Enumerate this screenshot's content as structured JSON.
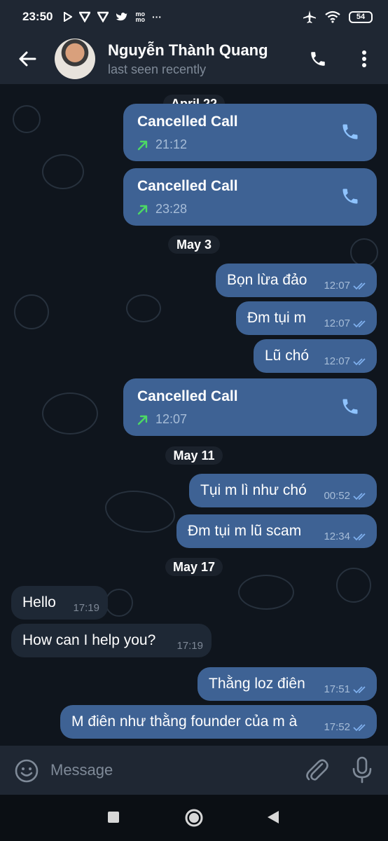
{
  "status_bar": {
    "time": "23:50",
    "left_icons": [
      "play-icon",
      "shield-icon",
      "shield-icon",
      "twitter-icon",
      "momo-icon",
      "more-dots-icon"
    ],
    "momo_text": "mo\nmo",
    "more": "···",
    "right_icons": [
      "airplane-icon",
      "wifi-icon",
      "battery-icon"
    ],
    "battery": "54"
  },
  "header": {
    "name": "Nguyễn Thành Quang",
    "status": "last seen recently"
  },
  "messages": [
    {
      "type": "date",
      "text": "April 22"
    },
    {
      "type": "call",
      "direction": "out",
      "title": "Cancelled Call",
      "time": "21:12"
    },
    {
      "type": "call",
      "direction": "out",
      "title": "Cancelled Call",
      "time": "23:28"
    },
    {
      "type": "date",
      "text": "May 3"
    },
    {
      "type": "text",
      "direction": "out",
      "text": "Bọn lừa đảo",
      "time": "12:07",
      "read": true
    },
    {
      "type": "text",
      "direction": "out",
      "text": "Đm tụi m",
      "time": "12:07",
      "read": true
    },
    {
      "type": "text",
      "direction": "out",
      "text": "Lũ chó",
      "time": "12:07",
      "read": true
    },
    {
      "type": "call",
      "direction": "out",
      "title": "Cancelled Call",
      "time": "12:07"
    },
    {
      "type": "date",
      "text": "May 11"
    },
    {
      "type": "text",
      "direction": "out",
      "text": "Tụi m lì như chó",
      "time": "00:52",
      "read": true
    },
    {
      "type": "text",
      "direction": "out",
      "text": "Đm tụi m lũ scam",
      "time": "12:34",
      "read": true
    },
    {
      "type": "date",
      "text": "May 17"
    },
    {
      "type": "text",
      "direction": "in",
      "text": "Hello",
      "time": "17:19"
    },
    {
      "type": "text",
      "direction": "in",
      "text": "How can I help you?",
      "time": "17:19"
    },
    {
      "type": "text",
      "direction": "out",
      "text": "Thằng loz điên",
      "time": "17:51",
      "read": true
    },
    {
      "type": "text",
      "direction": "out",
      "text": "M điên như thằng founder của m à",
      "time": "17:52",
      "read": true
    }
  ],
  "composer": {
    "placeholder": "Message"
  },
  "colors": {
    "outgoing_bubble": "#3e6294",
    "incoming_bubble": "#1e2835",
    "call_arrow": "#4cd964",
    "read_ticks": "#7fb0ee",
    "header_bg": "#1f2733"
  }
}
